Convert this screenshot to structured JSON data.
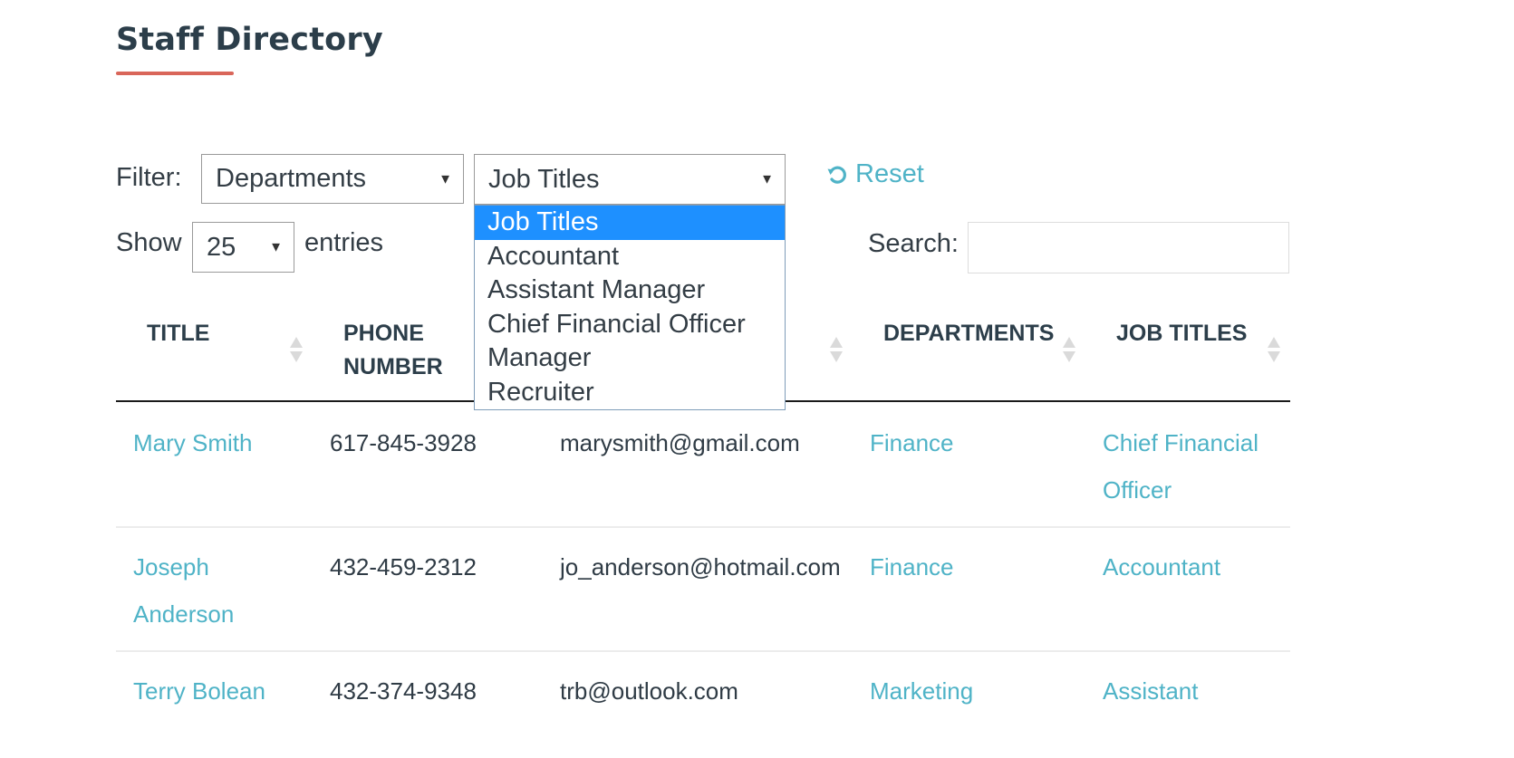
{
  "page": {
    "title": "Staff Directory",
    "accent_color": "#d9665a",
    "link_color": "#4fb3c7",
    "highlight_color": "#1e90ff"
  },
  "filters": {
    "label": "Filter:",
    "departments": {
      "selected": "Departments"
    },
    "job_titles": {
      "selected": "Job Titles",
      "is_open": true,
      "options": [
        "Job Titles",
        "Accountant",
        "Assistant Manager",
        "Chief Financial Officer",
        "Manager",
        "Recruiter"
      ],
      "highlighted_index": 0
    },
    "reset_label": "Reset",
    "reset_icon": "refresh-icon"
  },
  "length": {
    "show_label": "Show",
    "value": "25",
    "entries_label": "entries"
  },
  "search": {
    "label": "Search:",
    "value": "",
    "placeholder": ""
  },
  "table": {
    "columns": [
      {
        "label": "TITLE",
        "sort_icon": "sort-both-icon"
      },
      {
        "label": "PHONE NUMBER",
        "line1": "PHONE",
        "line2": "NUMBER",
        "sort_icon": "sort-both-icon"
      },
      {
        "label": "",
        "sort_icon": "sort-both-icon"
      },
      {
        "label": "DEPARTMENTS",
        "sort_icon": "sort-both-icon"
      },
      {
        "label": "JOB TITLES",
        "sort_icon": "sort-both-icon"
      }
    ],
    "rows": [
      {
        "name_line1": "Mary Smith",
        "name_line2": "",
        "phone": "617-845-3928",
        "email": "marysmith@gmail.com",
        "department": "Finance",
        "job_line1": "Chief Financial",
        "job_line2": "Officer"
      },
      {
        "name_line1": "Joseph",
        "name_line2": "Anderson",
        "phone": "432-459-2312",
        "email": "jo_anderson@hotmail.com",
        "department": "Finance",
        "job_line1": "Accountant",
        "job_line2": ""
      },
      {
        "name_line1": "Terry Bolean",
        "name_line2": "",
        "phone": "432-374-9348",
        "email": "trb@outlook.com",
        "department": "Marketing",
        "job_line1": "Assistant",
        "job_line2": ""
      }
    ]
  }
}
